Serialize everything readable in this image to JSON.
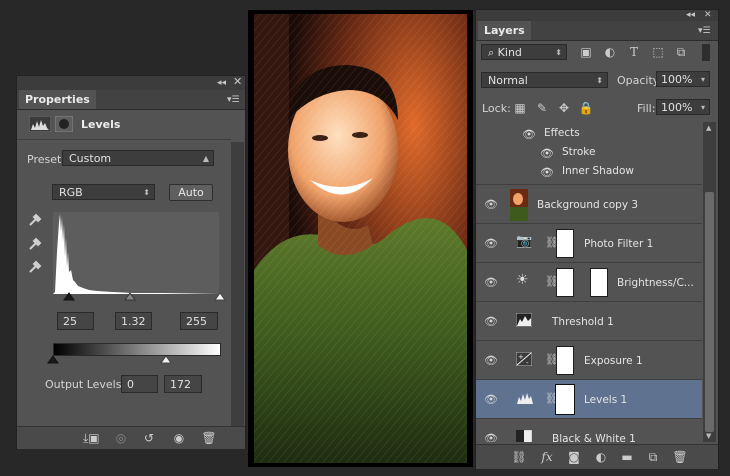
{
  "properties": {
    "tab_label": "Properties",
    "adjustment_title": "Levels",
    "preset_label": "Preset:",
    "preset_value": "Custom",
    "channel_value": "RGB",
    "auto_label": "Auto",
    "input_black": "25",
    "input_gamma": "1.32",
    "input_white": "255",
    "output_levels_label": "Output Levels:",
    "output_black": "0",
    "output_white": "172"
  },
  "layers": {
    "tab_label": "Layers",
    "filter_kind": "Kind",
    "blend_mode": "Normal",
    "opacity_label": "Opacity:",
    "opacity_value": "100%",
    "lock_label": "Lock:",
    "fill_label": "Fill:",
    "fill_value": "100%",
    "effects": {
      "label": "Effects",
      "items": [
        "Stroke",
        "Inner Shadow"
      ]
    },
    "items": [
      {
        "name": "Background copy 3"
      },
      {
        "name": "Photo Filter 1"
      },
      {
        "name": "Brightness/C..."
      },
      {
        "name": "Threshold 1"
      },
      {
        "name": "Exposure 1"
      },
      {
        "name": "Levels 1"
      },
      {
        "name": "Black & White 1"
      }
    ]
  }
}
